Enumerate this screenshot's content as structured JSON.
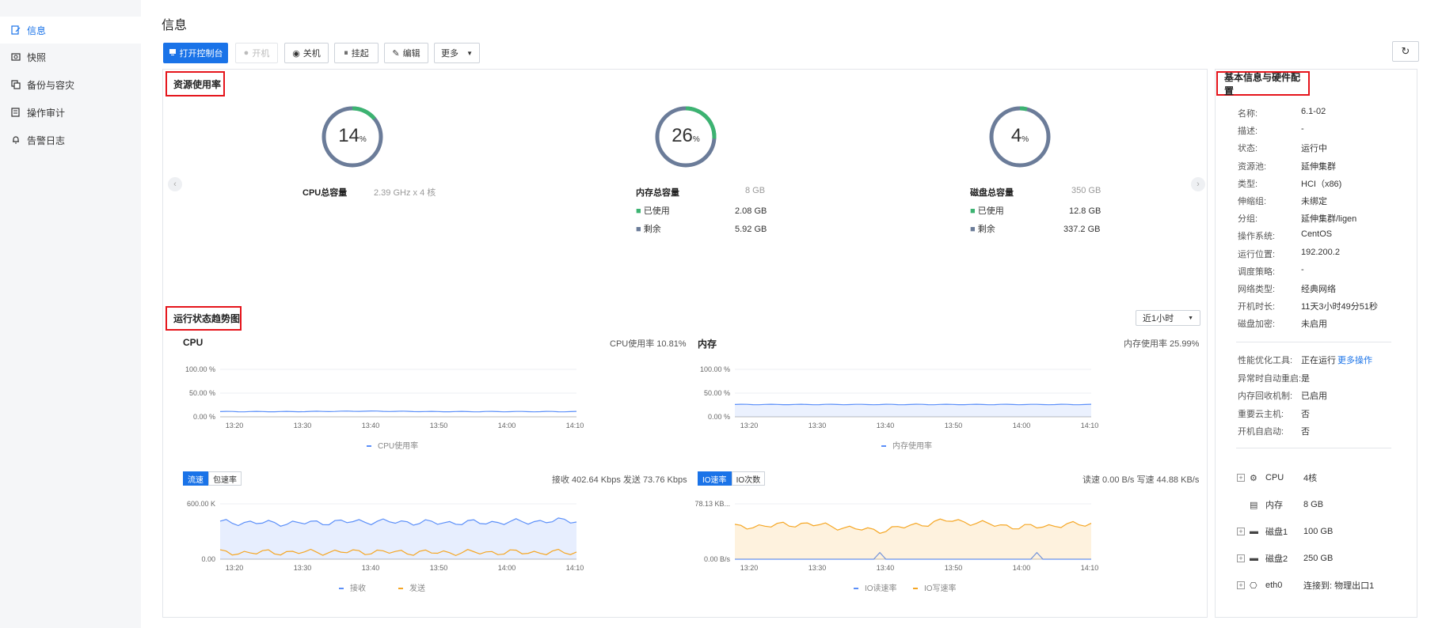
{
  "sidebar": {
    "items": [
      {
        "label": "信息",
        "icon": "info-doc-icon",
        "active": true
      },
      {
        "label": "快照",
        "icon": "camera-icon"
      },
      {
        "label": "备份与容灾",
        "icon": "copy-icon"
      },
      {
        "label": "操作审计",
        "icon": "audit-icon"
      },
      {
        "label": "告警日志",
        "icon": "bell-icon"
      }
    ]
  },
  "page": {
    "title": "信息"
  },
  "toolbar": {
    "open_console": "打开控制台",
    "power_on": "开机",
    "power_off": "关机",
    "suspend": "挂起",
    "edit": "编辑",
    "more": "更多"
  },
  "resource": {
    "title": "资源使用率",
    "cpu": {
      "pct": "14",
      "unit": "%",
      "label": "CPU总容量",
      "value": "2.39 GHz x 4 核"
    },
    "mem": {
      "pct": "26",
      "unit": "%",
      "label": "内存总容量",
      "value": "8 GB",
      "used_label": "已使用",
      "used": "2.08 GB",
      "free_label": "剩余",
      "free": "5.92 GB"
    },
    "disk": {
      "pct": "4",
      "unit": "%",
      "label": "磁盘总容量",
      "value": "350 GB",
      "used_label": "已使用",
      "used": "12.8 GB",
      "free_label": "剩余",
      "free": "337.2 GB"
    },
    "colors": {
      "used": "#3cb371",
      "rest": "#6b7c99"
    }
  },
  "trend": {
    "title": "运行状态趋势图",
    "range": "近1小时",
    "cpu": {
      "title": "CPU",
      "sub": "CPU使用率 10.81%",
      "legend": "CPU使用率",
      "yticks": [
        "100.00 %",
        "50.00 %",
        "0.00 %"
      ]
    },
    "mem": {
      "title": "内存",
      "sub": "内存使用率 25.99%",
      "legend": "内存使用率",
      "yticks": [
        "100.00 %",
        "50.00 %",
        "0.00 %"
      ]
    },
    "net": {
      "tab1": "流速",
      "tab2": "包速率",
      "sub": "接收 402.64 Kbps  发送 73.76 Kbps",
      "legend1": "接收",
      "legend2": "发送",
      "yticks": [
        "600.00 K",
        "0.00"
      ]
    },
    "io": {
      "tab1": "IO速率",
      "tab2": "IO次数",
      "sub": "读速 0.00 B/s  写速 44.88 KB/s",
      "legend1": "IO读速率",
      "legend2": "IO写速率",
      "yticks": [
        "78.13 KB...",
        "0.00 B/s"
      ]
    },
    "xticks": [
      "13:20",
      "13:30",
      "13:40",
      "13:50",
      "14:00",
      "14:10"
    ]
  },
  "chart_data": [
    {
      "type": "line",
      "title": "CPU",
      "ylabel": "",
      "ylim": [
        0,
        100
      ],
      "x": [
        "13:20",
        "13:30",
        "13:40",
        "13:50",
        "14:00",
        "14:10"
      ],
      "series": [
        {
          "name": "CPU使用率",
          "values": [
            11,
            11,
            12,
            11,
            11,
            11
          ]
        }
      ]
    },
    {
      "type": "area",
      "title": "内存",
      "ylim": [
        0,
        100
      ],
      "x": [
        "13:20",
        "13:30",
        "13:40",
        "13:50",
        "14:00",
        "14:10"
      ],
      "series": [
        {
          "name": "内存使用率",
          "values": [
            26,
            26,
            26,
            26,
            26,
            26
          ]
        }
      ]
    },
    {
      "type": "area",
      "x": [
        "13:20",
        "13:30",
        "13:40",
        "13:50",
        "14:00",
        "14:10"
      ],
      "ylim": [
        0,
        600
      ],
      "series": [
        {
          "name": "接收",
          "values": [
            400,
            390,
            410,
            395,
            400,
            420
          ]
        },
        {
          "name": "发送",
          "values": [
            70,
            75,
            80,
            72,
            74,
            73
          ]
        }
      ]
    },
    {
      "type": "area",
      "x": [
        "13:20",
        "13:30",
        "13:40",
        "13:50",
        "14:00",
        "14:10"
      ],
      "ylim": [
        0,
        78.13
      ],
      "series": [
        {
          "name": "IO读速率",
          "values": [
            0,
            0,
            0,
            0,
            0,
            0
          ]
        },
        {
          "name": "IO写速率",
          "values": [
            45,
            50,
            40,
            55,
            45,
            50
          ]
        }
      ]
    }
  ],
  "info": {
    "title": "基本信息与硬件配置",
    "rows": [
      {
        "k": "名称:",
        "v": "6.1-02"
      },
      {
        "k": "描述:",
        "v": "-"
      },
      {
        "k": "状态:",
        "v": "运行中"
      },
      {
        "k": "资源池:",
        "v": "延伸集群"
      },
      {
        "k": "类型:",
        "v": "HCI（x86)"
      },
      {
        "k": "伸缩组:",
        "v": "未绑定"
      },
      {
        "k": "分组:",
        "v": "延伸集群/ligen"
      },
      {
        "k": "操作系统:",
        "v": "CentOS"
      },
      {
        "k": "运行位置:",
        "v": "192.200.2"
      },
      {
        "k": "调度策略:",
        "v": "-"
      },
      {
        "k": "网络类型:",
        "v": "经典网络"
      },
      {
        "k": "开机时长:",
        "v": "11天3小时49分51秒"
      },
      {
        "k": "磁盘加密:",
        "v": "未启用"
      }
    ],
    "rows2": [
      {
        "k": "性能优化工具:",
        "v": "正在运行",
        "link": "更多操作"
      },
      {
        "k": "异常时自动重启:",
        "v": "是"
      },
      {
        "k": "内存回收机制:",
        "v": "已启用"
      },
      {
        "k": "重要云主机:",
        "v": "否"
      },
      {
        "k": "开机自启动:",
        "v": "否"
      }
    ],
    "hardware": [
      {
        "name": "CPU",
        "value": "4核",
        "icon": "cpu-icon",
        "expand": true
      },
      {
        "name": "内存",
        "value": "8 GB",
        "icon": "memory-icon",
        "expand": false
      },
      {
        "name": "磁盘1",
        "value": "100 GB",
        "icon": "disk-icon",
        "expand": true
      },
      {
        "name": "磁盘2",
        "value": "250 GB",
        "icon": "disk-icon",
        "expand": true
      },
      {
        "name": "eth0",
        "value": "连接到: 物理出口1",
        "icon": "nic-icon",
        "expand": true
      }
    ]
  }
}
